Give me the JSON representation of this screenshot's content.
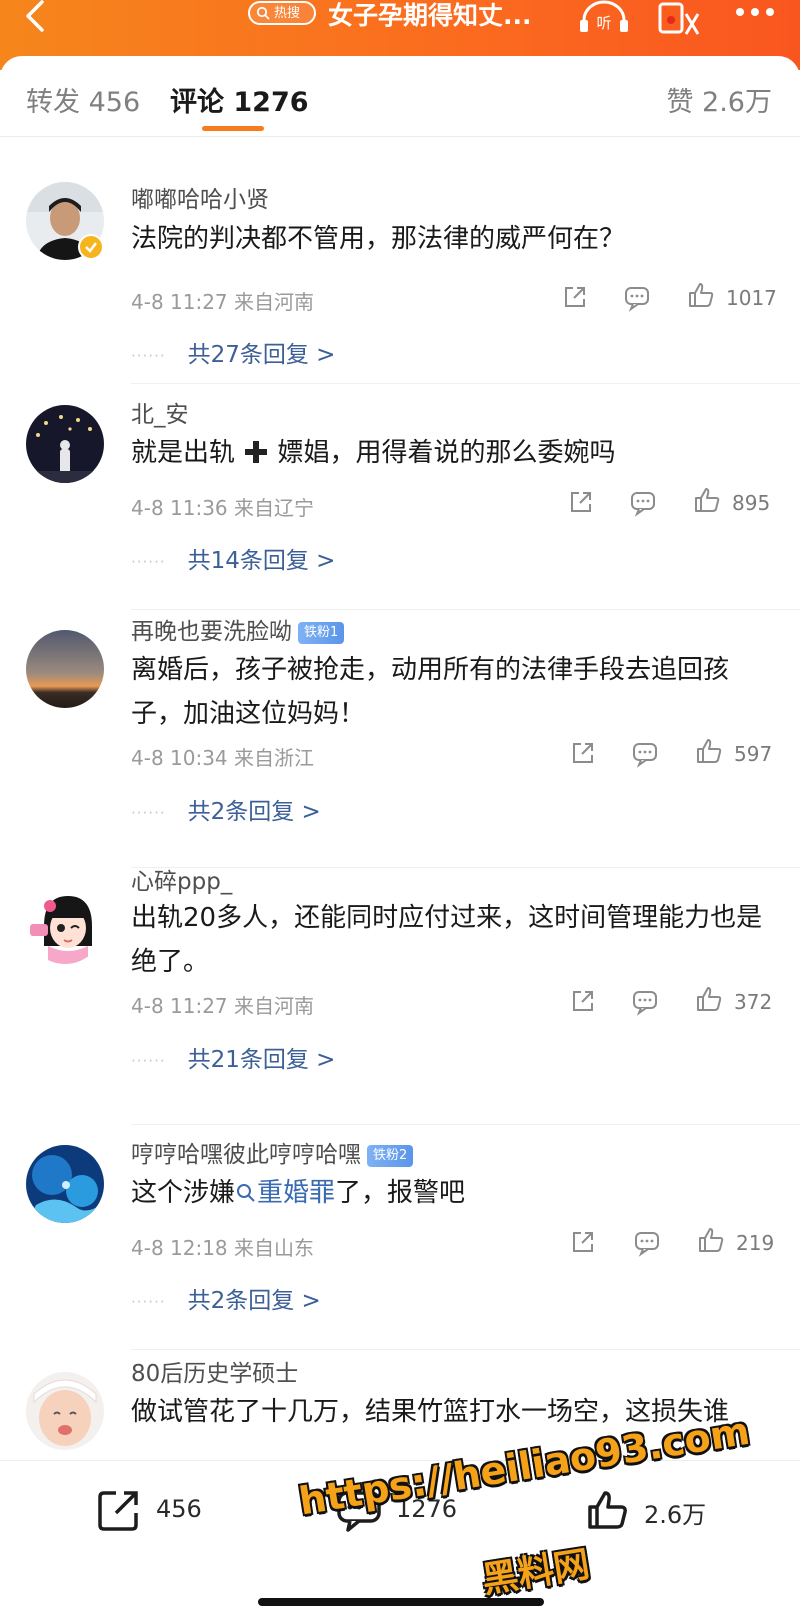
{
  "header": {
    "hot_label": "热搜",
    "title": "女子孕期得知丈...",
    "listen_label": "听"
  },
  "tabs": {
    "repost": "转发 456",
    "comments": "评论 1276",
    "likes": "赞 2.6万"
  },
  "comments": [
    {
      "user": "嘟嘟哈哈小贤",
      "text": "法院的判决都不管用，那法律的威严何在？",
      "time": "4-8 11:27",
      "location": "来自河南",
      "likes": "1017",
      "replies": "共27条回复 >"
    },
    {
      "user": "北_安",
      "text_a": "就是出轨 ",
      "text_b": " 嫖娼，用得着说的那么委婉吗",
      "time": "4-8 11:36",
      "location": "来自辽宁",
      "likes": "895",
      "replies": "共14条回复 >"
    },
    {
      "user": "再晚也要洗脸呦",
      "badge": "铁粉1",
      "text": "离婚后，孩子被抢走，动用所有的法律手段去追回孩子，加油这位妈妈！",
      "time": "4-8 10:34",
      "location": "来自浙江",
      "likes": "597",
      "replies": "共2条回复 >"
    },
    {
      "user": "心碎ppp_",
      "text": "出轨20多人，还能同时应付过来，这时间管理能力也是绝了。",
      "time": "4-8 11:27",
      "location": "来自河南",
      "likes": "372",
      "replies": "共21条回复 >"
    },
    {
      "user": "哼哼哈嘿彼此哼哼哈嘿",
      "badge": "铁粉2",
      "text_a": "这个涉嫌",
      "topic": "重婚罪",
      "text_b": "了，报警吧",
      "time": "4-8 12:18",
      "location": "来自山东",
      "likes": "219",
      "replies": "共2条回复 >"
    },
    {
      "user": "80后历史学硕士",
      "text": "做试管花了十几万，结果竹篮打水一场空，这损失谁"
    }
  ],
  "bottombar": {
    "repost_count": "456",
    "comment_count": "1276",
    "like_count": "2.6万"
  },
  "watermark": {
    "url": "https://heiliao93.com",
    "name": "黑料网"
  },
  "colors": {
    "header_orange": "#fb6a1f",
    "tab_accent": "#f67c1e",
    "link_blue": "#3c5f97",
    "watermark_gold": "#f5a219"
  }
}
